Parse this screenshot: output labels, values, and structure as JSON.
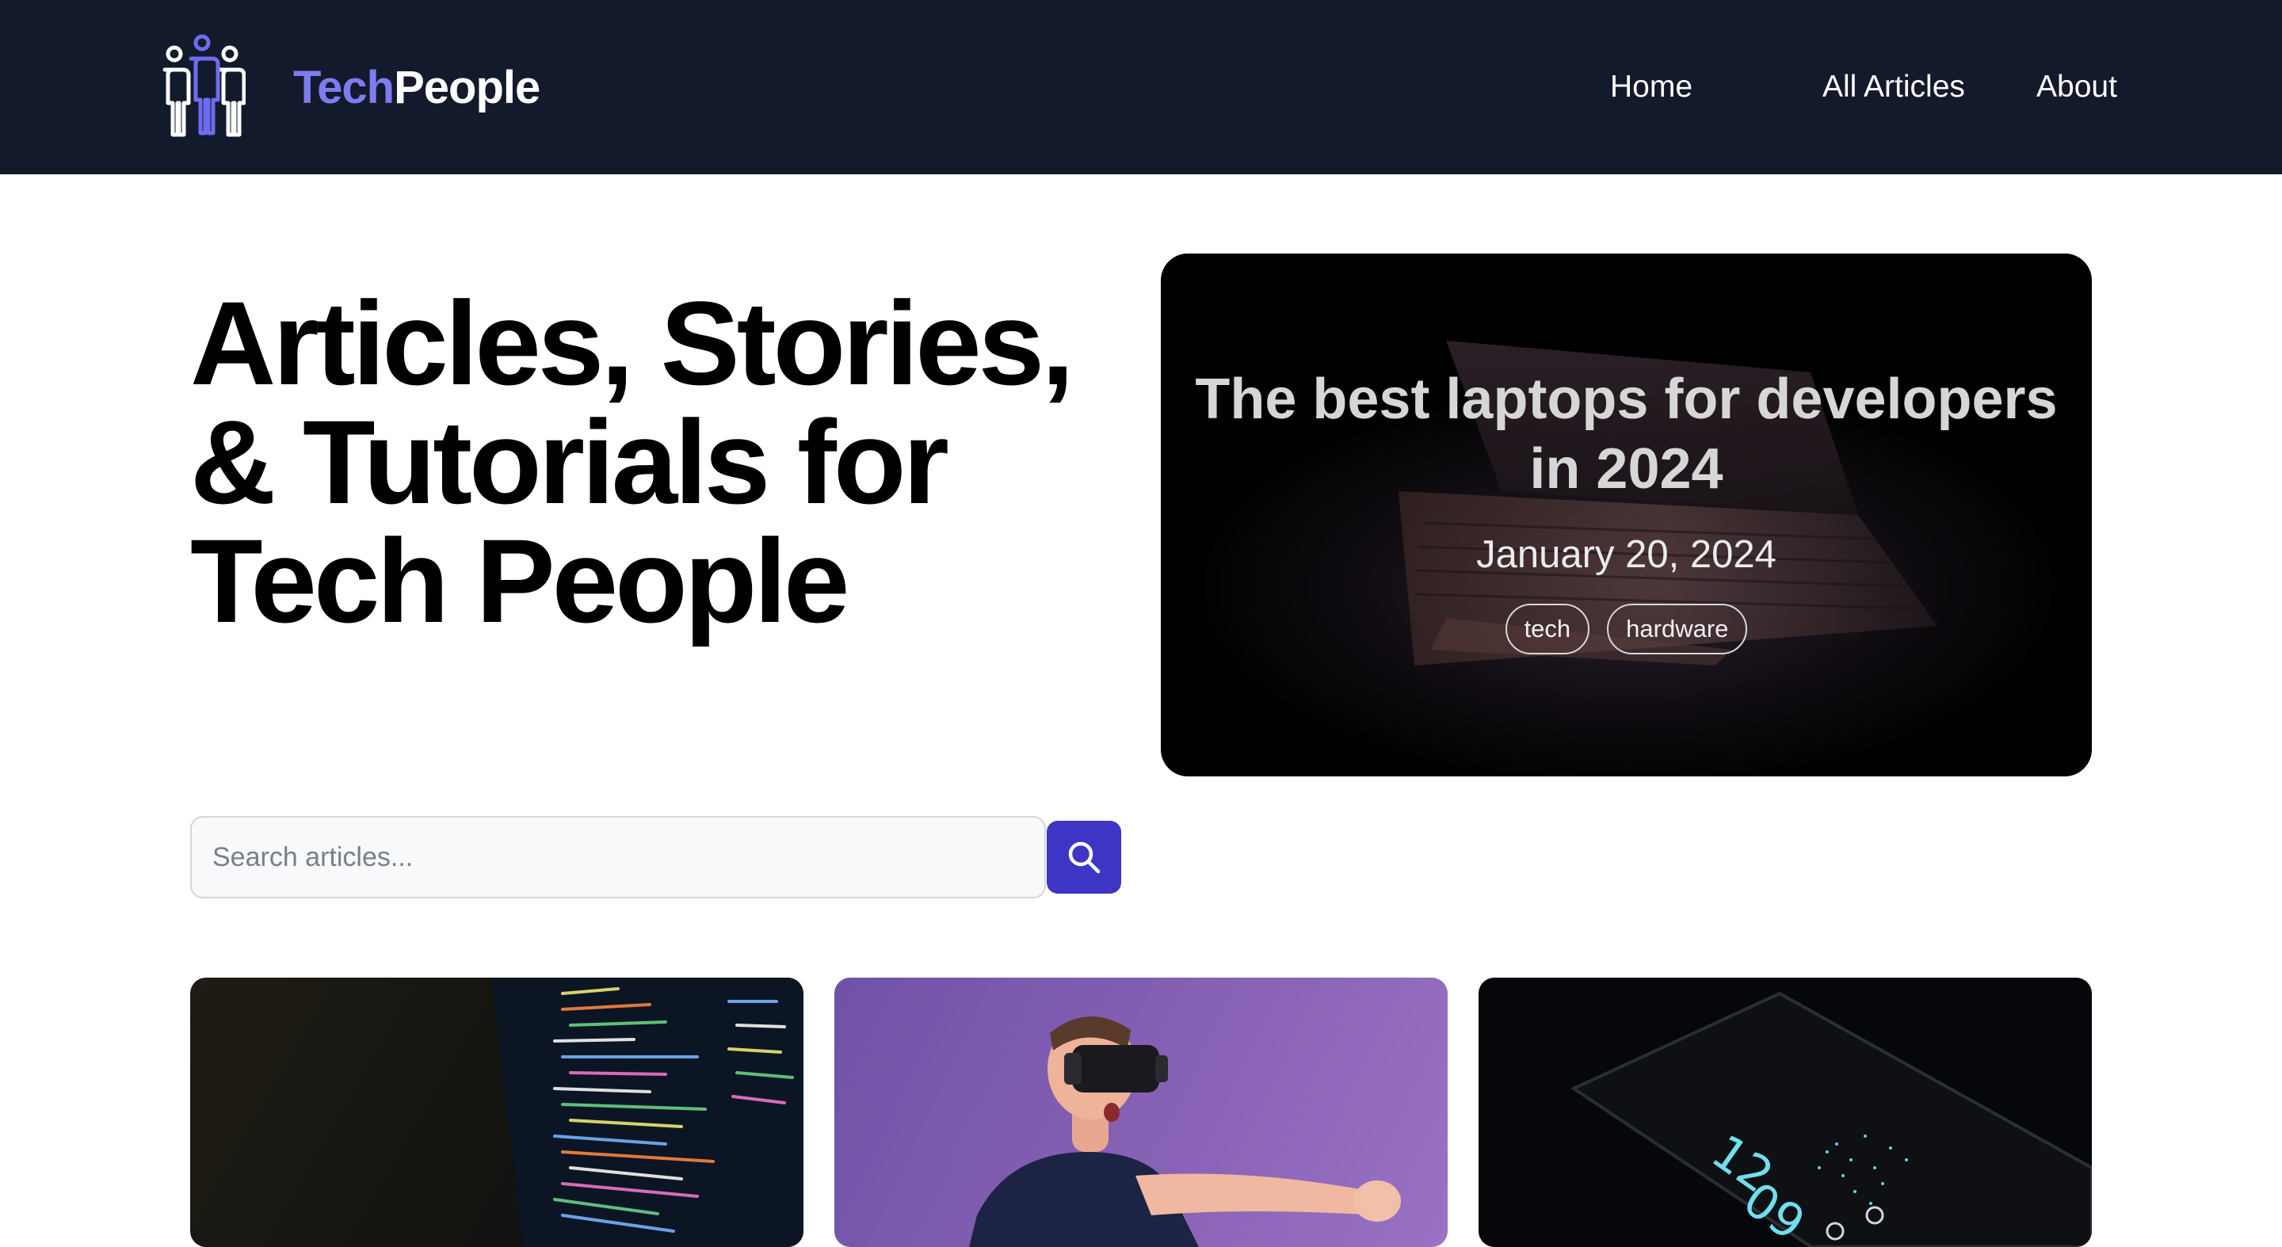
{
  "header": {
    "brand": {
      "part1": "Tech",
      "part2": "People"
    },
    "nav": [
      {
        "label": "Home"
      },
      {
        "label": "All Articles"
      },
      {
        "label": "About"
      }
    ]
  },
  "hero": {
    "title": "Articles, Stories, & Tutorials for Tech People"
  },
  "featured": {
    "title": "The best laptops for developers in 2024",
    "date": "January 20, 2024",
    "tags": [
      "tech",
      "hardware"
    ]
  },
  "search": {
    "placeholder": "Search articles...",
    "icon": "search-icon"
  },
  "cards": [
    {
      "image": "code-screen-image"
    },
    {
      "image": "vr-headset-image"
    },
    {
      "image": "smartphone-image"
    }
  ],
  "colors": {
    "header_bg": "#131a2c",
    "brand_accent": "#7f7cf0",
    "button_primary": "#3f35c4"
  },
  "icons": {
    "logo": "people-logo-icon",
    "search": "search-icon"
  }
}
